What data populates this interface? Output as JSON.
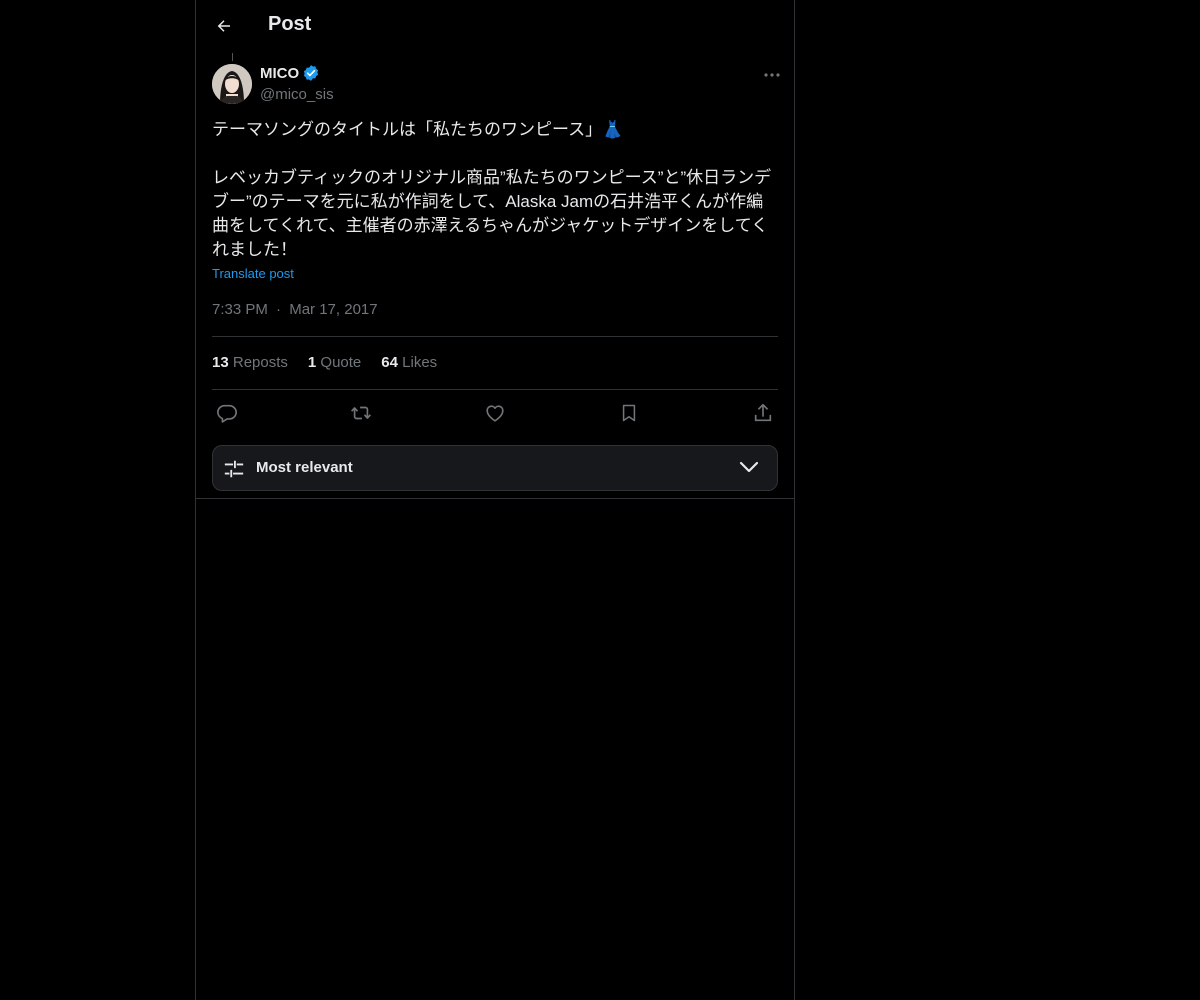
{
  "header": {
    "title": "Post",
    "back_icon": "arrow-left-icon"
  },
  "author": {
    "display_name": "MICO",
    "handle": "@mico_sis",
    "verified": true,
    "verified_color": "#1d9bf0"
  },
  "tweet": {
    "text": "テーマソングのタイトルは「私たちのワンピース」👗\n\nレベッカブティックのオリジナル商品”私たちのワンピース”と”休日ランデブー”のテーマを元に私が作詞をして、Alaska Jamの石井浩平くんが作編曲をしてくれて、主催者の赤澤えるちゃんがジャケットデザインをしてくれました！",
    "translate_label": "Translate post",
    "time": "7:33 PM",
    "separator": "·",
    "date": "Mar 17, 2017"
  },
  "stats": {
    "reposts_count": "13",
    "reposts_label": "Reposts",
    "quotes_count": "1",
    "quotes_label": "Quote",
    "likes_count": "64",
    "likes_label": "Likes"
  },
  "actions": [
    "reply-icon",
    "repost-icon",
    "like-icon",
    "bookmark-icon",
    "share-icon"
  ],
  "sort": {
    "label": "Most relevant",
    "icon": "sliders-icon",
    "chevron": "chevron-down-icon"
  },
  "colors": {
    "background": "#000000",
    "text": "#e7e9ea",
    "muted": "#71767b",
    "accent": "#1d9bf0",
    "border": "#2f3336"
  }
}
